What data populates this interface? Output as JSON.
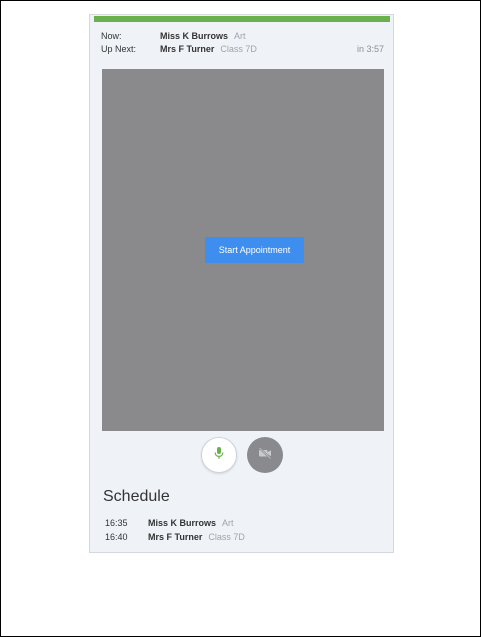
{
  "progress": {
    "fraction": 1.0,
    "color": "#6ab04c"
  },
  "current": {
    "now_label": "Now:",
    "now_name": "Miss K Burrows",
    "now_subject": "Art",
    "next_label": "Up Next:",
    "next_name": "Mrs F Turner",
    "next_class": "Class 7D",
    "countdown": "in 3:57"
  },
  "video": {
    "start_label": "Start Appointment",
    "button_color": "#3e8ef0",
    "background_color": "#8a8a8c"
  },
  "controls": {
    "mic_icon": "microphone-icon",
    "camera_icon": "camera-off-icon",
    "mic_color": "#6ab04c"
  },
  "schedule": {
    "title": "Schedule",
    "items": [
      {
        "time": "16:35",
        "name": "Miss K Burrows",
        "detail": "Art"
      },
      {
        "time": "16:40",
        "name": "Mrs F Turner",
        "detail": "Class 7D"
      }
    ]
  }
}
